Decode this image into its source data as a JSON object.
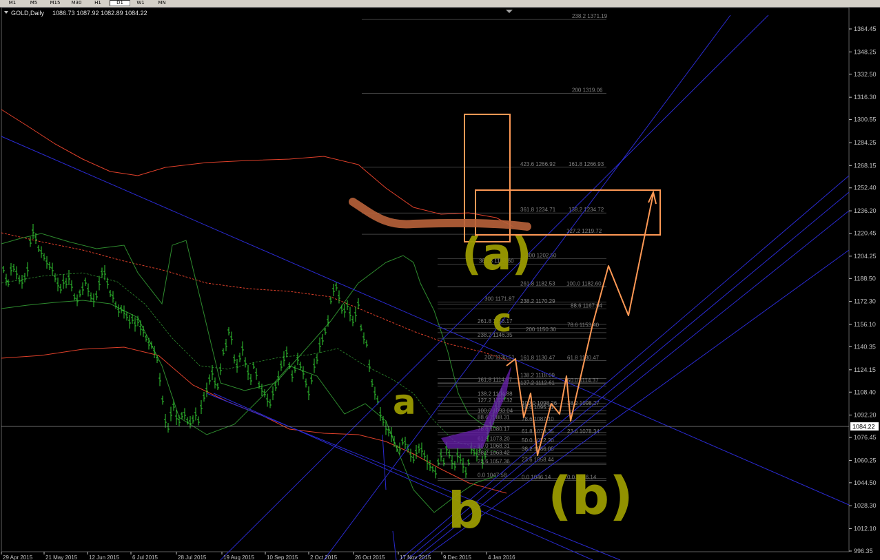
{
  "toolbar": {
    "buttons": [
      {
        "label": "M1"
      },
      {
        "label": "M5"
      },
      {
        "label": "M15"
      },
      {
        "label": "M30"
      },
      {
        "label": "H1"
      },
      {
        "label": "D1"
      },
      {
        "label": "W1"
      },
      {
        "label": "MN"
      }
    ],
    "active": "D1"
  },
  "chart_header": {
    "symbol": "GOLD,Daily",
    "ohlc": "1086.73 1087.92 1082.89 1084.22"
  },
  "chart_data": {
    "type": "candlestick",
    "symbol": "GOLD",
    "timeframe": "Daily",
    "open": 1086.73,
    "high": 1087.92,
    "low": 1082.89,
    "close": 1084.22,
    "current_price_label": "1084.22",
    "ylim": [
      996.35,
      1376
    ],
    "price_axis_ticks": [
      "1364.45",
      "1348.25",
      "1332.50",
      "1316.30",
      "1300.55",
      "1284.25",
      "1268.15",
      "1252.40",
      "1236.20",
      "1220.45",
      "1204.25",
      "1188.50",
      "1172.30",
      "1156.10",
      "1140.35",
      "1124.15",
      "1108.40",
      "1092.20",
      "1076.45",
      "1060.25",
      "1044.50",
      "1028.30",
      "1012.10",
      "996.35"
    ],
    "time_axis_ticks": [
      "29 Apr 2015",
      "21 May 2015",
      "12 Jun 2015",
      "6 Jul 2015",
      "28 Jul 2015",
      "19 Aug 2015",
      "10 Sep 2015",
      "2 Oct 2015",
      "26 Oct 2015",
      "17 Nov 2015",
      "9 Dec 2015",
      "4 Jan 2016"
    ],
    "fib_labels": [
      {
        "text": "238.2  1371.19",
        "price": 1371.19
      },
      {
        "text": "200  1319.06",
        "price": 1319.06
      },
      {
        "text": "423.6  1266.92",
        "price": 1266.92
      },
      {
        "text": "161.8  1266.93",
        "price": 1266.93
      },
      {
        "text": "361.8  1234.71",
        "price": 1234.71
      },
      {
        "text": "138.2  1234.72",
        "price": 1234.72
      },
      {
        "text": "127.2  1219.72",
        "price": 1219.72
      },
      {
        "text": "300  1202.50",
        "price": 1202.5
      },
      {
        "text": "361.8  1198.60",
        "price": 1198.6
      },
      {
        "text": "261.8  1182.53",
        "price": 1182.53
      },
      {
        "text": "100.0  1182.60",
        "price": 1182.6
      },
      {
        "text": "300  1171.87",
        "price": 1171.87
      },
      {
        "text": "238.2  1170.29",
        "price": 1170.29
      },
      {
        "text": "88.6  1167.04",
        "price": 1167.04
      },
      {
        "text": "261.8  1156.17",
        "price": 1156.17
      },
      {
        "text": "78.6  1153.40",
        "price": 1153.4
      },
      {
        "text": "200  1150.30",
        "price": 1150.3
      },
      {
        "text": "238.2  1146.35",
        "price": 1146.35
      },
      {
        "text": "200  1130.51",
        "price": 1130.51
      },
      {
        "text": "161.8  1130.47",
        "price": 1130.47
      },
      {
        "text": "61.8  1130.47",
        "price": 1130.47
      },
      {
        "text": "161.8  1114.87",
        "price": 1114.87
      },
      {
        "text": "138.2  1118.09",
        "price": 1118.09
      },
      {
        "text": "127.2  1112.61",
        "price": 1112.61
      },
      {
        "text": "50.0  1114.37",
        "price": 1114.37
      },
      {
        "text": "138.2  1104.88",
        "price": 1104.88
      },
      {
        "text": "127.2  1100.32",
        "price": 1100.32
      },
      {
        "text": "100.0  1098.26",
        "price": 1098.26
      },
      {
        "text": "38.2  1098.27",
        "price": 1098.27
      },
      {
        "text": "88.6  1095.31",
        "price": 1095.31
      },
      {
        "text": "100.0  1093.04",
        "price": 1093.04
      },
      {
        "text": "78.6  1087.10",
        "price": 1087.1
      },
      {
        "text": "88.6  1088.31",
        "price": 1088.31
      },
      {
        "text": "78.6  1080.17",
        "price": 1080.17
      },
      {
        "text": "61.8  1078.35",
        "price": 1078.35
      },
      {
        "text": "23.6  1078.34",
        "price": 1078.34
      },
      {
        "text": "61.8  1073.20",
        "price": 1073.2
      },
      {
        "text": "50.0  1072.20",
        "price": 1072.2
      },
      {
        "text": "50.0  1068.31",
        "price": 1068.31
      },
      {
        "text": "38.2  1066.05",
        "price": 1066.05
      },
      {
        "text": "38.2  1063.42",
        "price": 1063.42
      },
      {
        "text": "23.6  1058.44",
        "price": 1058.44
      },
      {
        "text": "23.6  1057.36",
        "price": 1057.36
      },
      {
        "text": "0.0  1047.58",
        "price": 1047.58
      },
      {
        "text": "0.0  1046.14",
        "price": 1046.14
      },
      {
        "text": "0.0  1046.14",
        "price": 1046.14
      }
    ],
    "annotations": [
      {
        "text": "(a)",
        "color": "#9a9a00"
      },
      {
        "text": "c",
        "color": "#9a9a00"
      },
      {
        "text": "a",
        "color": "#9a9a00"
      },
      {
        "text": "b",
        "color": "#9a9a00"
      },
      {
        "text": "(b)",
        "color": "#9a9a00"
      }
    ],
    "colors": {
      "background": "#000000",
      "candles": "#32cd32",
      "bollinger": "#2e8b2e",
      "envelope": "#e0402a",
      "trendlines": "#2a2ad0",
      "forecast_arrows": "#ff9955",
      "boxes": "#ff9955",
      "annotation": "#9a9a00",
      "fib_text": "#808080"
    }
  }
}
